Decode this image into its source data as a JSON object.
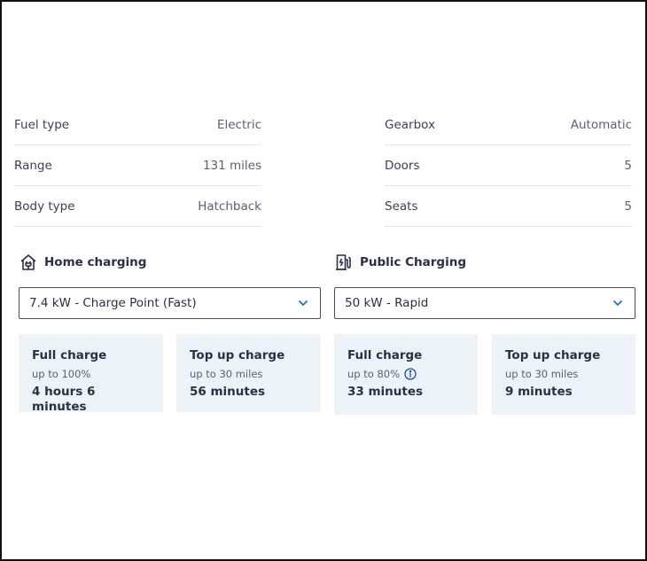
{
  "specs_left": [
    {
      "label": "Fuel type",
      "value": "Electric"
    },
    {
      "label": "Range",
      "value": "131 miles"
    },
    {
      "label": "Body type",
      "value": "Hatchback"
    }
  ],
  "specs_right": [
    {
      "label": "Gearbox",
      "value": "Automatic"
    },
    {
      "label": "Doors",
      "value": "5"
    },
    {
      "label": "Seats",
      "value": "5"
    }
  ],
  "home": {
    "title": "Home charging",
    "icon": "house-plug-icon",
    "selected": "7.4 kW - Charge Point (Fast)",
    "cards": [
      {
        "title": "Full charge",
        "sub": "up to 100%",
        "time": "4 hours 6 minutes"
      },
      {
        "title": "Top up charge",
        "sub": "up to 30 miles",
        "time": "56 minutes"
      }
    ]
  },
  "public": {
    "title": "Public Charging",
    "icon": "charging-station-icon",
    "selected": "50 kW - Rapid",
    "cards": [
      {
        "title": "Full charge",
        "sub": "up to 80%",
        "time": "33 minutes"
      },
      {
        "title": "Top up charge",
        "sub": "up to 30 miles",
        "time": "9 minutes"
      }
    ]
  },
  "colors": {
    "card_bg": "#eef3f9",
    "accent": "#1a73c8",
    "text": "#2b2f45"
  }
}
